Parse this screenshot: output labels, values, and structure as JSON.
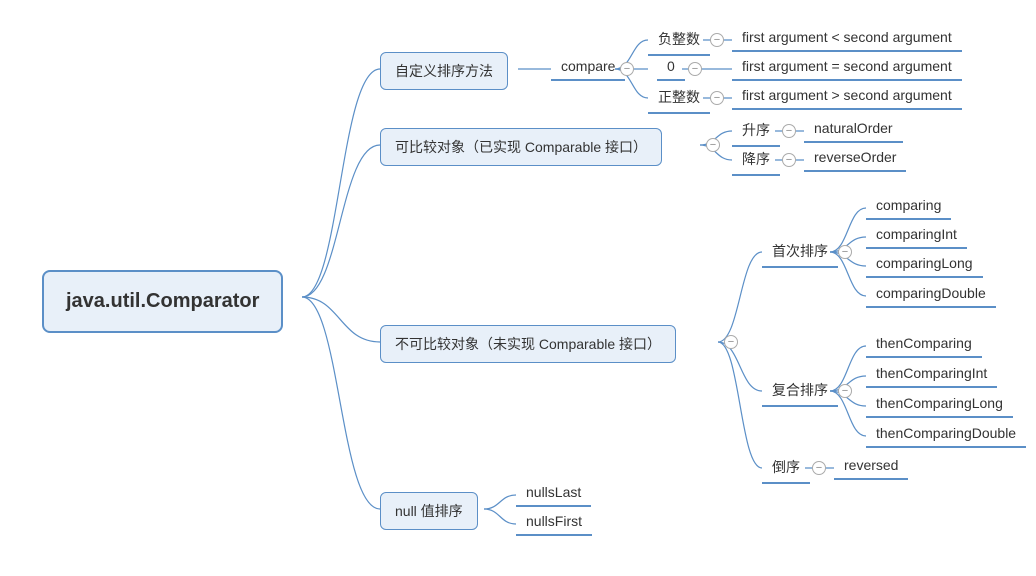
{
  "root": "java.util.Comparator",
  "b1": {
    "label": "自定义排序方法",
    "c1": "compare",
    "r1": {
      "k": "负整数",
      "v": "first argument < second argument"
    },
    "r2": {
      "k": "0",
      "v": "first argument = second argument"
    },
    "r3": {
      "k": "正整数",
      "v": "first argument > second argument"
    }
  },
  "b2": {
    "label": "可比较对象（已实现 Comparable 接口）",
    "r1": {
      "k": "升序",
      "v": "naturalOrder"
    },
    "r2": {
      "k": "降序",
      "v": "reverseOrder"
    }
  },
  "b3": {
    "label": "不可比较对象（未实现 Comparable 接口）",
    "g1": {
      "label": "首次排序",
      "items": [
        "comparing",
        "comparingInt",
        "comparingLong",
        "comparingDouble"
      ]
    },
    "g2": {
      "label": "复合排序",
      "items": [
        "thenComparing",
        "thenComparingInt",
        "thenComparingLong",
        "thenComparingDouble"
      ]
    },
    "g3": {
      "k": "倒序",
      "v": "reversed"
    }
  },
  "b4": {
    "label": "null 值排序",
    "items": [
      "nullsLast",
      "nullsFirst"
    ]
  }
}
